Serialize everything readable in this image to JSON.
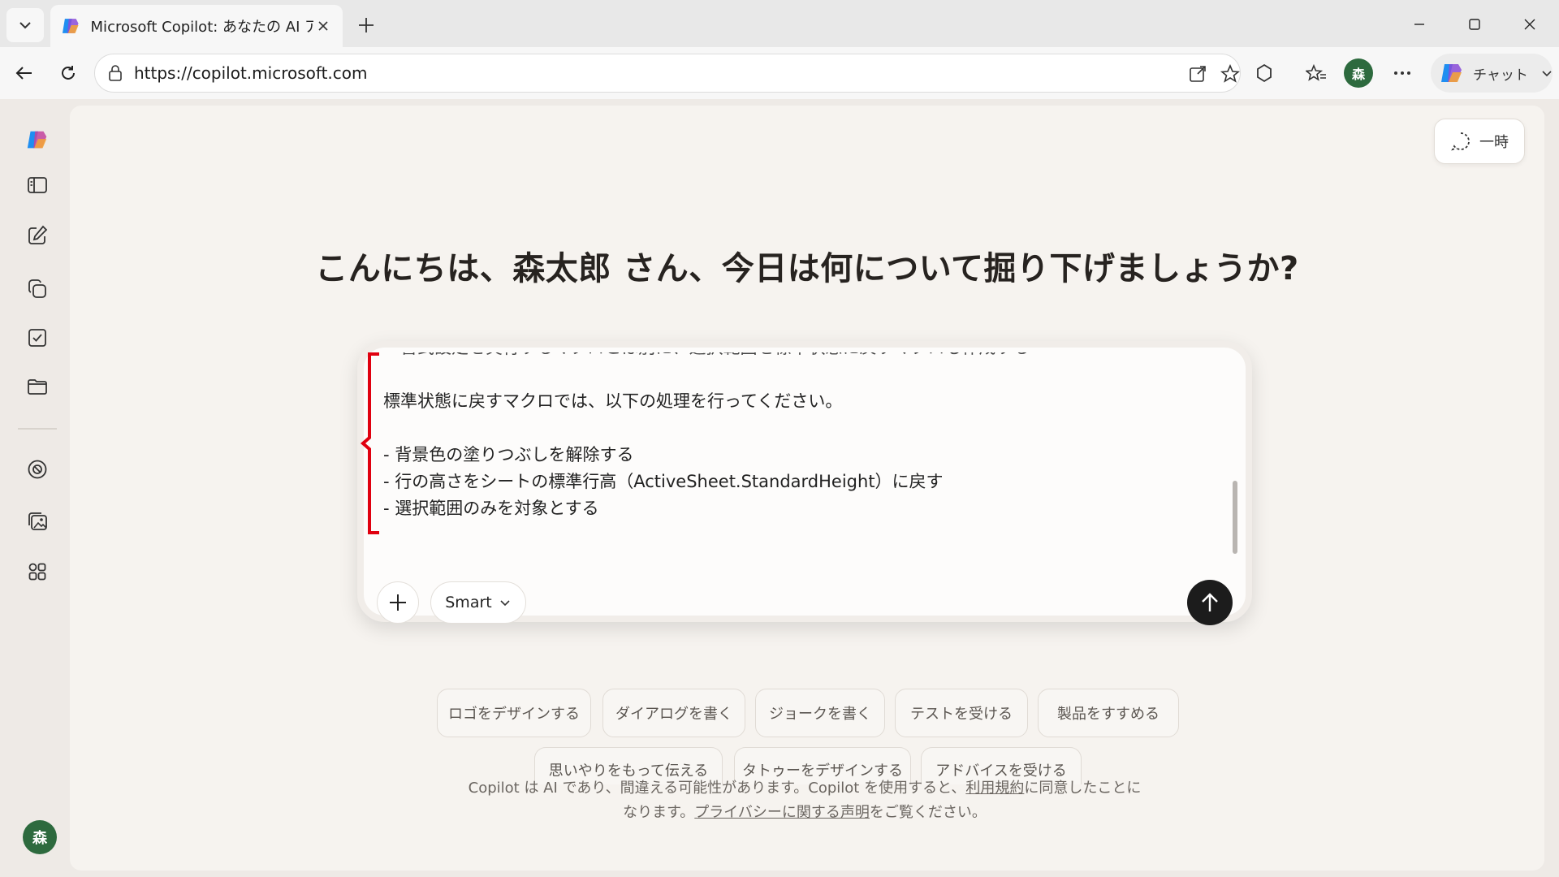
{
  "browser": {
    "tab_title": "Microsoft Copilot: あなたの AI アシスタント",
    "url": "https://copilot.microsoft.com",
    "chat_label": "チャット",
    "profile_initial": "森"
  },
  "header": {
    "temp_label": "一時"
  },
  "main": {
    "greeting": "こんにちは、森太郎 さん、今日は何について掘り下げましょうか?",
    "composer": {
      "lines": [
        "・書式設定を実行するマクロとは別に、選択範囲を標準状態に戻すマクロも作成する",
        "",
        "標準状態に戻すマクロでは、以下の処理を行ってください。",
        "",
        "- 背景色の塗りつぶしを解除する",
        "- 行の高さをシートの標準行高（ActiveSheet.StandardHeight）に戻す",
        "- 選択範囲のみを対象とする"
      ],
      "mode_label": "Smart"
    },
    "suggestions_row1": [
      "ロゴをデザインする",
      "ダイアログを書く",
      "ジョークを書く",
      "テストを受ける",
      "製品をすすめる"
    ],
    "suggestions_row2": [
      "思いやりをもって伝える",
      "タトゥーをデザインする",
      "アドバイスを受ける"
    ],
    "disclaimer": {
      "part1": "Copilot は AI であり、間違える可能性があります。Copilot を使用すると、",
      "terms_link": "利用規約",
      "part2": "に同意したことに",
      "part3": "なります。",
      "privacy_link": "プライバシーに関する声明",
      "part4": "をご覧ください。"
    }
  },
  "sidebar": {
    "avatar_initial": "森",
    "items": [
      "copilot-logo",
      "sidebar-toggle",
      "new-chat",
      "library",
      "tasks",
      "folder",
      "discover",
      "images",
      "apps"
    ]
  },
  "colors": {
    "accent_red": "#e0000f",
    "send_button": "#1c1c1c",
    "page_bg": "#f6f3ef"
  }
}
